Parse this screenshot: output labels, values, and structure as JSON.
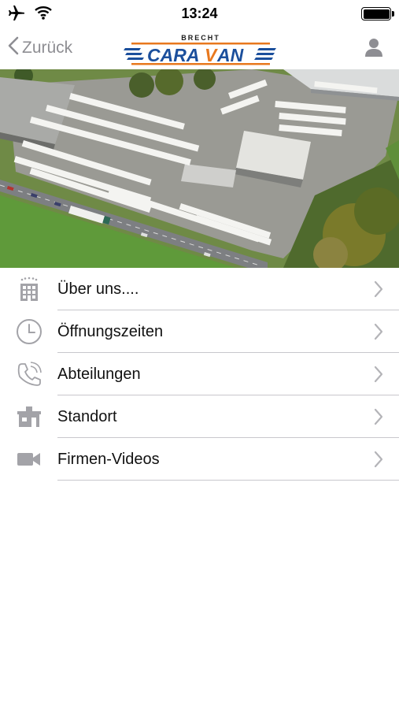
{
  "status_bar": {
    "time": "13:24"
  },
  "nav": {
    "back_label": "Zurück",
    "logo_top": "BRECHT",
    "logo_main": "CaraVan"
  },
  "hero": {
    "alt": "aerial photo of caravan dealership"
  },
  "menu": {
    "items": [
      {
        "label": "Über uns....",
        "icon": "building-icon"
      },
      {
        "label": "Öffnungszeiten",
        "icon": "clock-icon"
      },
      {
        "label": "Abteilungen",
        "icon": "phone-icon"
      },
      {
        "label": "Standort",
        "icon": "location-building-icon"
      },
      {
        "label": "Firmen-Videos",
        "icon": "video-camera-icon"
      }
    ]
  },
  "colors": {
    "accent_blue": "#1b4f9c",
    "accent_orange": "#e8781e",
    "icon_gray": "#a3a3a8",
    "separator": "#c8c7cc"
  }
}
